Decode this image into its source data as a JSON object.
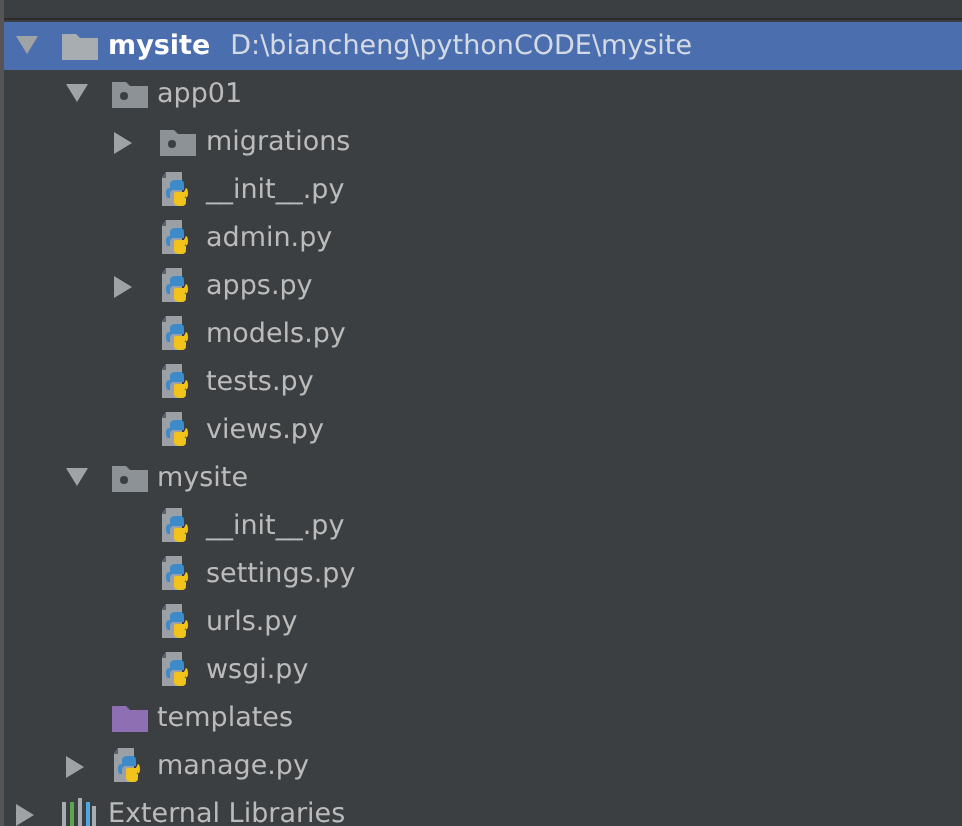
{
  "tree": [
    {
      "kind": "folder",
      "name": "mysite",
      "path": "D:\\biancheng\\pythonCODE\\mysite",
      "expanded": true,
      "selected": true,
      "children": [
        {
          "kind": "package",
          "name": "app01",
          "expanded": true,
          "selected": false,
          "children": [
            {
              "kind": "package",
              "name": "migrations",
              "expanded": false,
              "selected": false
            },
            {
              "kind": "python",
              "name": "__init__.py",
              "selected": false
            },
            {
              "kind": "python",
              "name": "admin.py",
              "selected": false
            },
            {
              "kind": "python",
              "name": "apps.py",
              "expanded": false,
              "selected": false
            },
            {
              "kind": "python",
              "name": "models.py",
              "selected": false
            },
            {
              "kind": "python",
              "name": "tests.py",
              "selected": false
            },
            {
              "kind": "python",
              "name": "views.py",
              "selected": false
            }
          ]
        },
        {
          "kind": "package",
          "name": "mysite",
          "expanded": true,
          "selected": false,
          "children": [
            {
              "kind": "python",
              "name": "__init__.py",
              "selected": false
            },
            {
              "kind": "python",
              "name": "settings.py",
              "selected": false
            },
            {
              "kind": "python",
              "name": "urls.py",
              "selected": false
            },
            {
              "kind": "python",
              "name": "wsgi.py",
              "selected": false
            }
          ]
        },
        {
          "kind": "templates",
          "name": "templates",
          "selected": false
        },
        {
          "kind": "python",
          "name": "manage.py",
          "expanded": false,
          "selected": false
        }
      ]
    },
    {
      "kind": "libraries",
      "name": "External Libraries",
      "expanded": false,
      "selected": false
    }
  ]
}
